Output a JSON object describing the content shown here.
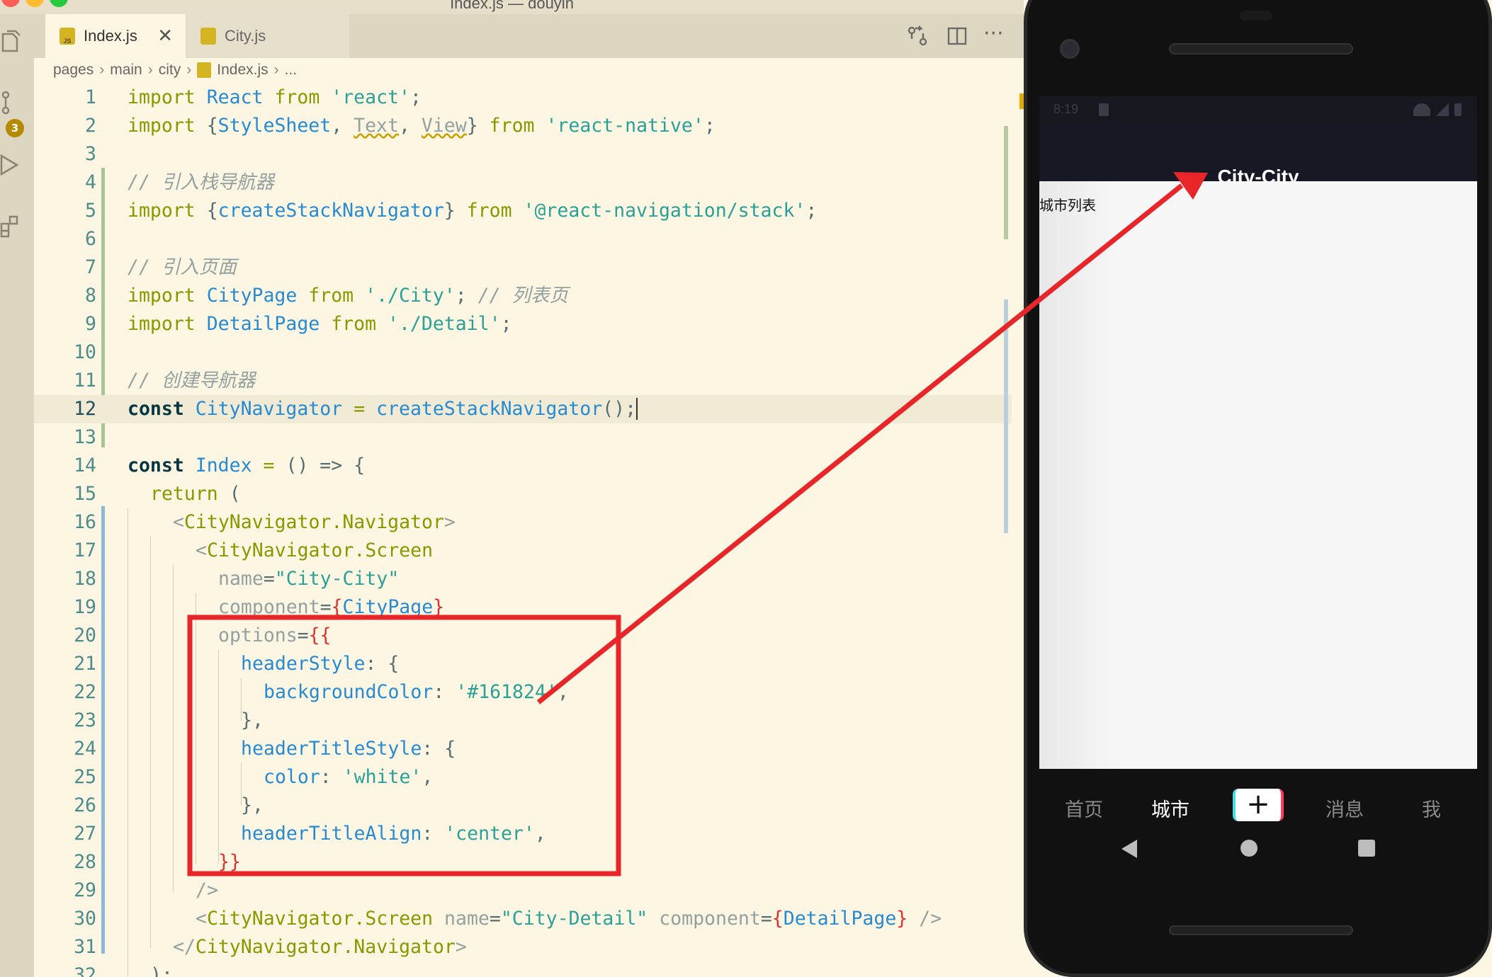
{
  "window": {
    "title": "Index.js — douyin"
  },
  "activity_bar": {
    "scm_badge": "3"
  },
  "tabs": [
    {
      "label": "Index.js"
    },
    {
      "label": "City.js"
    }
  ],
  "breadcrumb": {
    "items": [
      "pages",
      "main",
      "city",
      "Index.js",
      "..."
    ]
  },
  "editor": {
    "current_line": "12"
  },
  "code_lines": [
    {
      "n": "1"
    },
    {
      "n": "2"
    },
    {
      "n": "3"
    },
    {
      "n": "4"
    },
    {
      "n": "5"
    },
    {
      "n": "6"
    },
    {
      "n": "7"
    },
    {
      "n": "8"
    },
    {
      "n": "9"
    },
    {
      "n": "10"
    },
    {
      "n": "11"
    },
    {
      "n": "12"
    },
    {
      "n": "13"
    },
    {
      "n": "14"
    },
    {
      "n": "15"
    },
    {
      "n": "16"
    },
    {
      "n": "17"
    },
    {
      "n": "18"
    },
    {
      "n": "19"
    },
    {
      "n": "20"
    },
    {
      "n": "21"
    },
    {
      "n": "22"
    },
    {
      "n": "23"
    },
    {
      "n": "24"
    },
    {
      "n": "25"
    },
    {
      "n": "26"
    },
    {
      "n": "27"
    },
    {
      "n": "28"
    },
    {
      "n": "29"
    },
    {
      "n": "30"
    },
    {
      "n": "31"
    },
    {
      "n": "32"
    }
  ],
  "code_tokens": {
    "l1": [
      "import",
      "React",
      "from",
      "'react'",
      ";"
    ],
    "l2": [
      "import",
      "{",
      "StyleSheet",
      ", ",
      "Text",
      ", ",
      "View",
      "}",
      "from",
      "'react-native'",
      ";"
    ],
    "l4": "// 引入栈导航器",
    "l5": [
      "import",
      "{",
      "createStackNavigator",
      "}",
      "from",
      "'@react-navigation/stack'",
      ";"
    ],
    "l7": "// 引入页面",
    "l8": [
      "import",
      "CityPage",
      "from",
      "'./City'",
      ";",
      "// 列表页"
    ],
    "l9": [
      "import",
      "DetailPage",
      "from",
      "'./Detail'",
      ";"
    ],
    "l11": "// 创建导航器",
    "l12": [
      "const",
      "CityNavigator",
      "=",
      "createStackNavigator",
      "();"
    ],
    "l14": [
      "const",
      "Index",
      "=",
      "() =>",
      "{"
    ],
    "l15": [
      "return",
      "("
    ],
    "l16": [
      "<",
      "CityNavigator.Navigator",
      ">"
    ],
    "l17": [
      "<",
      "CityNavigator.Screen"
    ],
    "l18": [
      "name",
      "=",
      "\"City-City\""
    ],
    "l19": [
      "component",
      "=",
      "{",
      "CityPage",
      "}"
    ],
    "l20": [
      "options",
      "=",
      "{{"
    ],
    "l21": [
      "headerStyle",
      ": {"
    ],
    "l22": [
      "backgroundColor",
      ": ",
      "'#161824'",
      ","
    ],
    "l23": "},",
    "l24": [
      "headerTitleStyle",
      ": {"
    ],
    "l25": [
      "color",
      ": ",
      "'white'",
      ","
    ],
    "l26": "},",
    "l27": [
      "headerTitleAlign",
      ": ",
      "'center'",
      ","
    ],
    "l28": "}}",
    "l29": "/>",
    "l30": [
      "<",
      "CityNavigator.Screen",
      "name",
      "=",
      "\"City-Detail\"",
      "component",
      "=",
      "{",
      "DetailPage",
      "}",
      "/>"
    ],
    "l31": [
      "</",
      "CityNavigator.Navigator",
      ">"
    ],
    "l32": ");"
  },
  "phone": {
    "status_time": "8:19",
    "header_title": "City-City",
    "content_text": "城市列表",
    "tabbar": [
      "首页",
      "城市",
      "+",
      "消息",
      "我"
    ],
    "active_tab": "城市"
  },
  "colors": {
    "editor_bg": "#fdf6e3",
    "header_bg": "#161824",
    "annotation_red": "#e8262a"
  },
  "icons": [
    "files-icon",
    "source-control-icon",
    "run-debug-icon",
    "extensions-icon",
    "close-icon",
    "compare-icon",
    "split-editor-icon",
    "more-icon",
    "back-icon",
    "home-icon",
    "recents-icon"
  ]
}
